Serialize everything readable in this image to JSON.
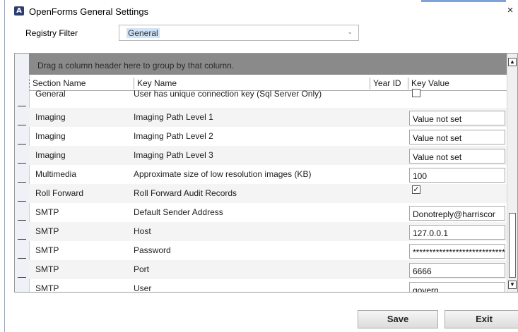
{
  "window": {
    "title": "OpenForms General Settings",
    "app_icon_glyph": "A",
    "close_glyph": "×"
  },
  "filter": {
    "label": "Registry Filter",
    "value": "General"
  },
  "grid": {
    "group_hint": "Drag a column header here to group by that column.",
    "columns": [
      "Section Name",
      "Key Name",
      "Year ID",
      "Key Value"
    ],
    "rows": [
      {
        "section": "General",
        "key": "User has unique connection key (Sql Server Only)",
        "year": "",
        "value_type": "checkbox",
        "checked": false
      },
      {
        "section": "Imaging",
        "key": "Imaging Path Level 1",
        "year": "",
        "value_type": "text",
        "value": "Value not set"
      },
      {
        "section": "Imaging",
        "key": "Imaging Path Level 2",
        "year": "",
        "value_type": "text",
        "value": "Value not set"
      },
      {
        "section": "Imaging",
        "key": "Imaging Path Level 3",
        "year": "",
        "value_type": "text",
        "value": "Value not set"
      },
      {
        "section": "Multimedia",
        "key": "Approximate size of low resolution images (KB)",
        "year": "",
        "value_type": "text",
        "value": "100"
      },
      {
        "section": "Roll Forward",
        "key": "Roll Forward Audit Records",
        "year": "",
        "value_type": "checkbox",
        "checked": true
      },
      {
        "section": "SMTP",
        "key": "Default Sender Address",
        "year": "",
        "value_type": "text",
        "value": "Donotreply@harriscor"
      },
      {
        "section": "SMTP",
        "key": "Host",
        "year": "",
        "value_type": "text",
        "value": "127.0.0.1"
      },
      {
        "section": "SMTP",
        "key": "Password",
        "year": "",
        "value_type": "text",
        "value": "****************************"
      },
      {
        "section": "SMTP",
        "key": "Port",
        "year": "",
        "value_type": "text",
        "value": "6666"
      },
      {
        "section": "SMTP",
        "key": "User",
        "year": "",
        "value_type": "text",
        "value": "govern"
      }
    ]
  },
  "buttons": {
    "save": "Save",
    "exit": "Exit"
  },
  "icons": {
    "dropdown": "chevron-down-icon",
    "check_glyph": "✓",
    "scroll_up_glyph": "▲",
    "scroll_down_glyph": "▼"
  },
  "colors": {
    "group_panel": "#8a8a8a",
    "selection": "#cfe3f8"
  }
}
